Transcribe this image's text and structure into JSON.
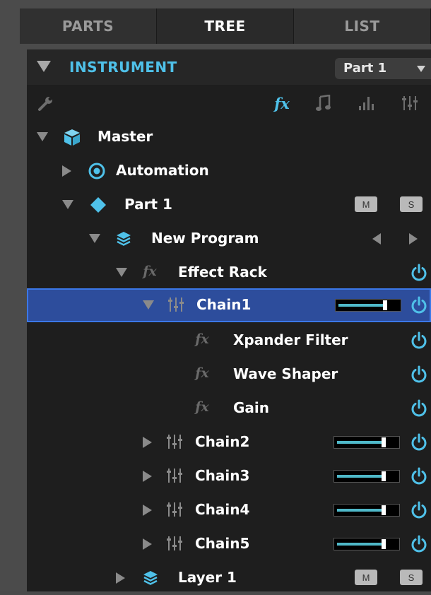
{
  "tabs": [
    {
      "label": "PARTS"
    },
    {
      "label": "TREE"
    },
    {
      "label": "LIST"
    }
  ],
  "header": {
    "title": "INSTRUMENT",
    "part_selector": "Part 1"
  },
  "toolbar": {
    "wrench_icon": "wrench-icon",
    "fx_label": "fx",
    "icons": [
      "note-icon",
      "bars-icon",
      "mixer-icon"
    ]
  },
  "colors": {
    "accent": "#4fc1e9",
    "selection": "#2d4d9c",
    "power": "#4fc1e9",
    "slider_fill": "#4fb9c9"
  },
  "tree": {
    "master": {
      "label": "Master"
    },
    "automation": {
      "label": "Automation"
    },
    "part1": {
      "label": "Part 1",
      "m": "M",
      "s": "S"
    },
    "program": {
      "label": "New Program"
    },
    "effect_rack": {
      "label": "Effect Rack",
      "fx": "fx"
    },
    "chain1": {
      "label": "Chain1",
      "level": 0.78
    },
    "xpander": {
      "label": "Xpander Filter",
      "fx": "fx"
    },
    "wave": {
      "label": "Wave Shaper",
      "fx": "fx"
    },
    "gain": {
      "label": "Gain",
      "fx": "fx"
    },
    "chain2": {
      "label": "Chain2",
      "level": 0.78
    },
    "chain3": {
      "label": "Chain3",
      "level": 0.78
    },
    "chain4": {
      "label": "Chain4",
      "level": 0.78
    },
    "chain5": {
      "label": "Chain5",
      "level": 0.78
    },
    "layer1": {
      "label": "Layer 1",
      "m": "M",
      "s": "S"
    }
  }
}
